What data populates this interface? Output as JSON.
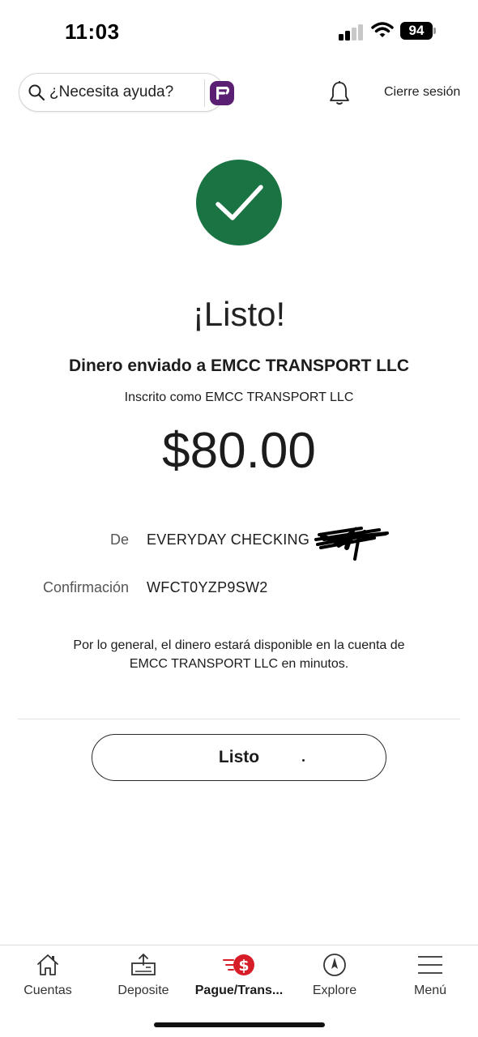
{
  "status_bar": {
    "time": "11:03",
    "battery": "94",
    "icons": [
      "signal-icon",
      "wifi-icon",
      "battery-icon"
    ]
  },
  "header": {
    "help_placeholder": "¿Necesita ayuda?",
    "logout_label": "Cierre sesión",
    "icons": [
      "search-icon",
      "fargo-assistant-icon",
      "bell-icon"
    ]
  },
  "confirmation": {
    "title": "¡Listo!",
    "sent_to": "Dinero enviado a EMCC TRANSPORT LLC",
    "enrolled_as": "Inscrito como EMCC TRANSPORT LLC",
    "amount": "$80.00",
    "from_label": "De",
    "from_value": "EVERYDAY CHECKING",
    "confirmation_label": "Confirmación",
    "confirmation_value": "WFCT0YZP9SW2",
    "note": "Por lo general, el dinero estará disponible en la cuenta de EMCC TRANSPORT LLC en minutos.",
    "done_label": "Listo"
  },
  "nav": {
    "items": [
      {
        "label": "Cuentas",
        "icon": "home-icon"
      },
      {
        "label": "Deposite",
        "icon": "deposit-icon"
      },
      {
        "label": "Pague/Trans...",
        "icon": "pay-transfer-icon",
        "active": true
      },
      {
        "label": "Explore",
        "icon": "compass-icon"
      },
      {
        "label": "Menú",
        "icon": "menu-icon"
      }
    ]
  },
  "colors": {
    "success_green": "#1a7342",
    "brand_red": "#d71e28",
    "assistant_purple": "#5a1f73"
  }
}
